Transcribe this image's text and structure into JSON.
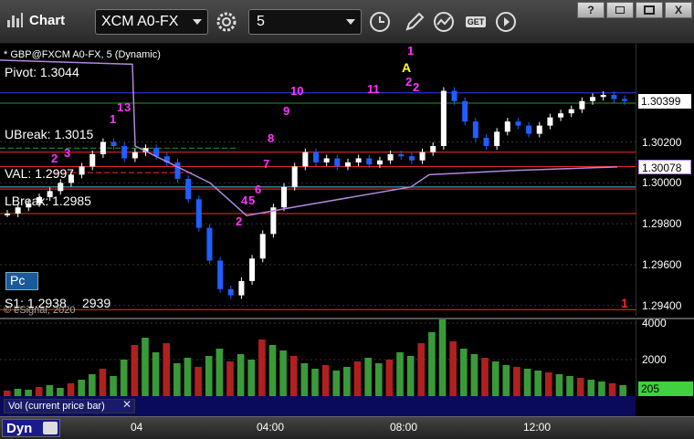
{
  "window": {
    "title": "Chart"
  },
  "toolbar": {
    "symbol": "XCM A0-FX",
    "interval": "5",
    "get_label": "GET"
  },
  "window_buttons": [
    "?",
    "",
    "",
    "X"
  ],
  "chart": {
    "header": "* GBP@FXCM A0-FX, 5 (Dynamic)",
    "levels": [
      {
        "label": "Pivot: 1.3044",
        "price": 1.3044,
        "color": "#2a40ff"
      },
      {
        "label": "UBreak: 1.3015",
        "price": 1.3015,
        "color": "#ff2a2a"
      },
      {
        "label": "VAL: 1.2997",
        "price": 1.2997,
        "color": "#ff2a2a"
      },
      {
        "label": "LBreak: 1.2985",
        "price": 1.2985,
        "color": "#ff2a2a"
      },
      {
        "label": "S1: 1.2938",
        "price": 1.2938,
        "color": "#ff2a2a"
      }
    ],
    "s1_extra": "2939",
    "pc_button": "Pc",
    "copyright": "© eSignal, 2020",
    "ymin": 1.2935,
    "ymax": 1.3068,
    "annotations": {
      "magenta": [
        "1",
        "2",
        "3",
        "1",
        "2",
        "3",
        "4",
        "5",
        "6",
        "7",
        "8",
        "9",
        "10",
        "11",
        "1",
        "2",
        "2"
      ],
      "yellow": "A",
      "red_marker": "1"
    },
    "price_labels": [
      "1.30200",
      "1.30000",
      "1.29800",
      "1.29600",
      "1.29400"
    ],
    "price_ticks": [
      1.302,
      1.3,
      1.298,
      1.296,
      1.294
    ],
    "current_price": "1.30399",
    "current_price_value": 1.30399,
    "vwap_price": "1.30078",
    "vwap_price_value": 1.30078
  },
  "volume": {
    "axis_labels": [
      "4000",
      "2000"
    ],
    "axis_ticks": [
      4000,
      2000
    ],
    "ymax": 4200,
    "current": "205",
    "current_value": 205,
    "study_label": "Vol (current price bar)"
  },
  "timebar": {
    "dyn_label": "Dyn",
    "labels": [
      "04",
      "04:00",
      "08:00",
      "12:00"
    ]
  },
  "colors": {
    "up_candle": "#ffffff",
    "down_candle": "#1f5fff",
    "green_line": "#1f9a1f",
    "purple_line": "#b088e0",
    "cyan_line": "#40c8e0",
    "vol_up": "#3a9a3a",
    "vol_down": "#b02020"
  }
}
